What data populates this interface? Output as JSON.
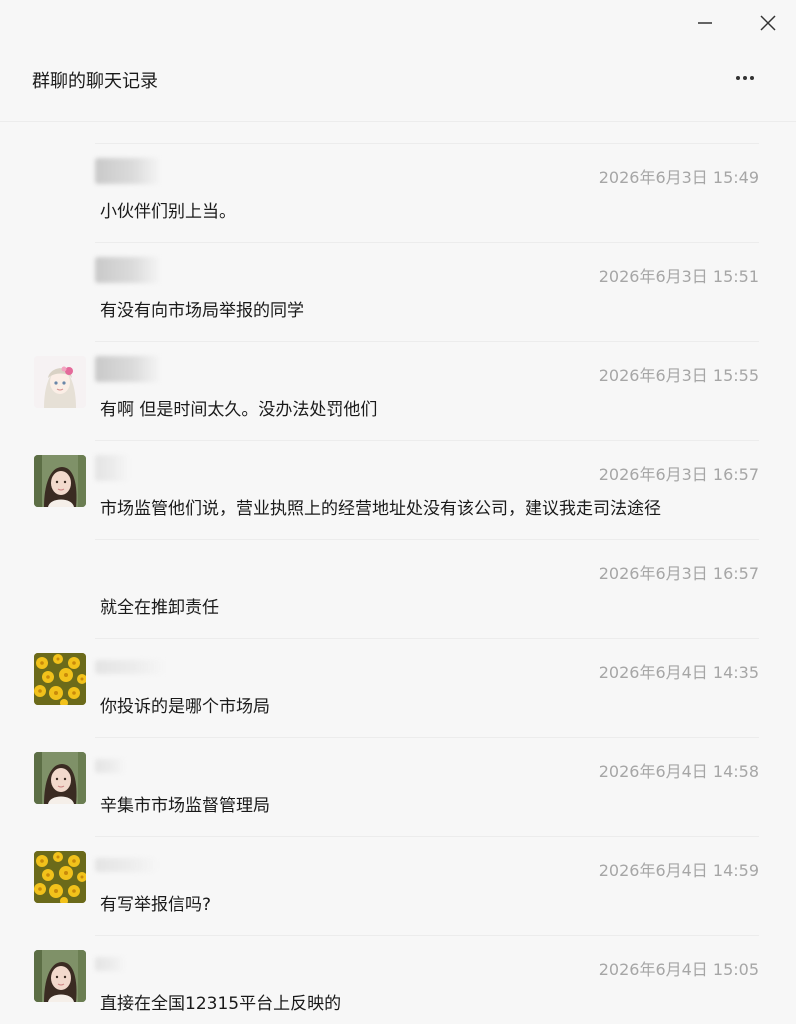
{
  "window": {
    "minimize_icon": "minimize-icon",
    "close_icon": "close-icon"
  },
  "header": {
    "title": "群聊的聊天记录",
    "more_icon": "more-icon"
  },
  "messages": [
    {
      "avatar": "none",
      "timestamp": "2026年6月3日 15:49",
      "text": "小伙伴们别上当。"
    },
    {
      "avatar": "none",
      "timestamp": "2026年6月3日 15:51",
      "text": "有没有向市场局举报的同学"
    },
    {
      "avatar": "anime-girl",
      "timestamp": "2026年6月3日 15:55",
      "text": "有啊  但是时间太久。没办法处罚他们"
    },
    {
      "avatar": "girl-photo",
      "timestamp": "2026年6月3日 16:57",
      "text": "市场监管他们说，营业执照上的经营地址处没有该公司，建议我走司法途径"
    },
    {
      "avatar": "none",
      "timestamp": "2026年6月3日 16:57",
      "text": "就全在推卸责任"
    },
    {
      "avatar": "flower",
      "timestamp": "2026年6月4日 14:35",
      "text": "你投诉的是哪个市场局"
    },
    {
      "avatar": "girl-photo",
      "timestamp": "2026年6月4日 14:58",
      "text": "辛集市市场监督管理局"
    },
    {
      "avatar": "flower",
      "timestamp": "2026年6月4日 14:59",
      "text": "有写举报信吗?"
    },
    {
      "avatar": "girl-photo",
      "timestamp": "2026年6月4日 15:05",
      "text": "直接在全国12315平台上反映的"
    }
  ]
}
